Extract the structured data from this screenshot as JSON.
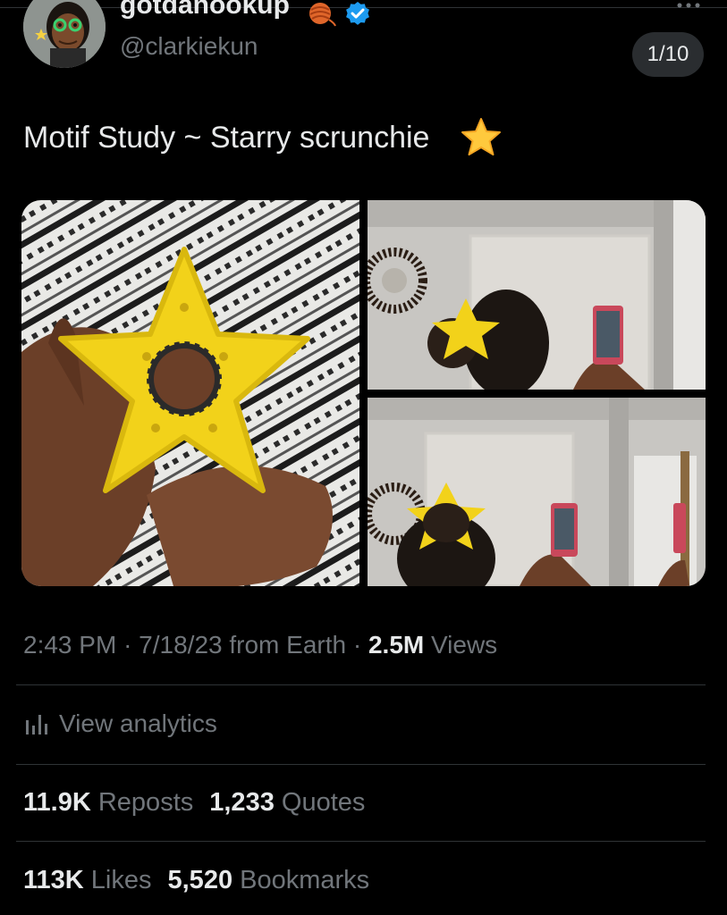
{
  "author": {
    "display_name": "gotdanookup",
    "handle": "@clarkiekun",
    "avatar_icon": "avatar-icon",
    "yarn_icon": "yarn-ball-icon",
    "verified_icon": "verified-badge-icon"
  },
  "media_counter": "1/10",
  "tweet": {
    "text": "Motif Study ~ Starry scrunchie",
    "emoji_icon": "star-emoji-icon"
  },
  "media": [
    {
      "icon": "photo-star-scrunchie-in-hands"
    },
    {
      "icon": "photo-mirror-selfie-back"
    },
    {
      "icon": "photo-mirror-selfie-top"
    }
  ],
  "meta": {
    "time": "2:43 PM",
    "sep1": "·",
    "date": "7/18/23",
    "source": "from Earth",
    "sep2": "·",
    "views_count": "2.5M",
    "views_label": "Views"
  },
  "analytics": {
    "label": "View analytics",
    "icon": "analytics-icon"
  },
  "stats": {
    "reposts_count": "11.9K",
    "reposts_label": "Reposts",
    "quotes_count": "1,233",
    "quotes_label": "Quotes",
    "likes_count": "113K",
    "likes_label": "Likes",
    "bookmarks_count": "5,520",
    "bookmarks_label": "Bookmarks"
  },
  "colors": {
    "background": "#000000",
    "primary_text": "#e7e9ea",
    "secondary_text": "#71767b",
    "verified": "#1d9bf0",
    "divider": "#2f3336"
  }
}
